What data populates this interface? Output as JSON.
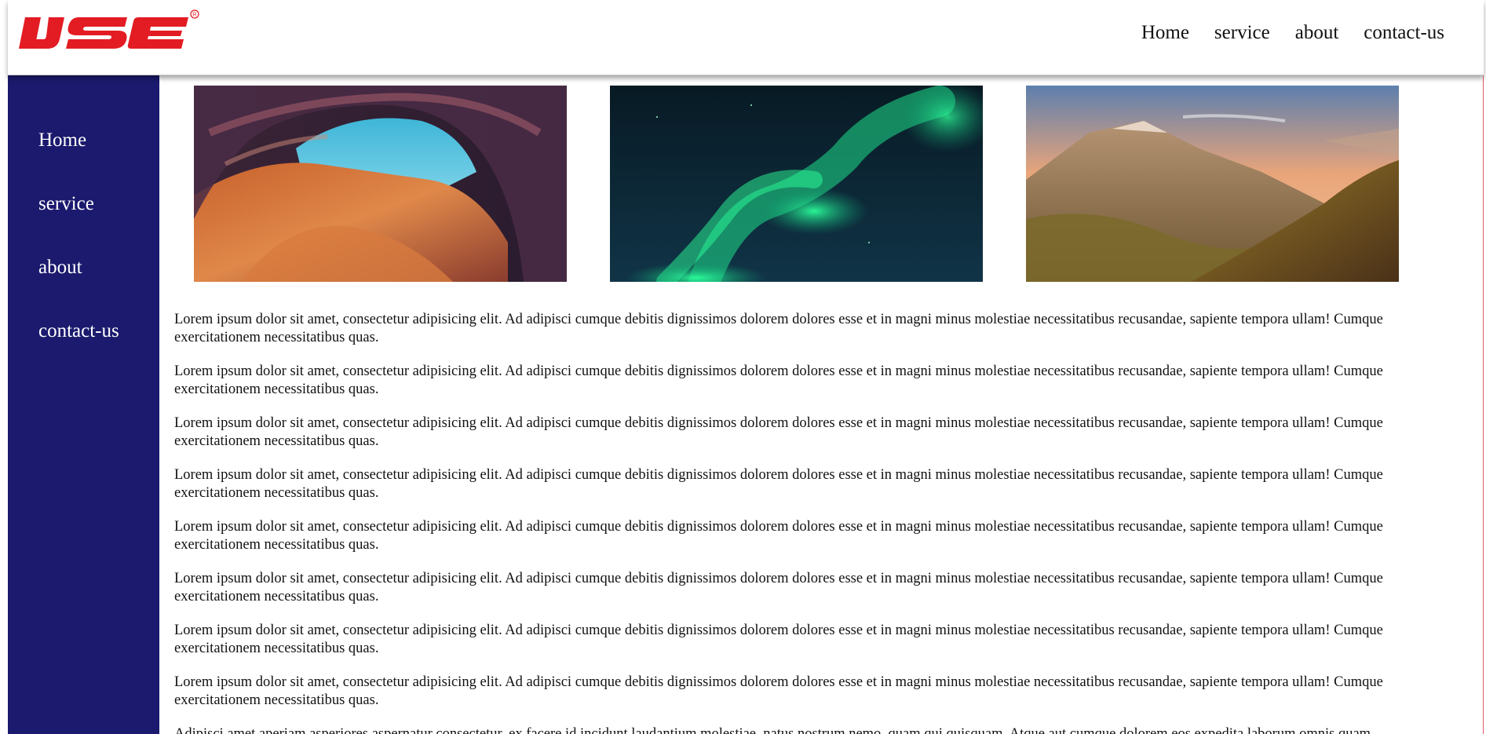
{
  "brand": {
    "logo_text": "IJSE",
    "logo_color": "#e31c23"
  },
  "header": {
    "nav": [
      "Home",
      "service",
      "about",
      "contact-us"
    ]
  },
  "sidebar": {
    "background": "#1b1a6e",
    "items": [
      "Home",
      "service",
      "about",
      "contact-us"
    ]
  },
  "gallery": {
    "images": [
      {
        "name": "canyon-image"
      },
      {
        "name": "aurora-image"
      },
      {
        "name": "mountain-image"
      }
    ]
  },
  "content": {
    "paragraphs": [
      "Lorem ipsum dolor sit amet, consectetur adipisicing elit. Ad adipisci cumque debitis dignissimos dolorem dolores esse et in magni minus molestiae necessitatibus recusandae, sapiente tempora ullam! Cumque exercitationem necessitatibus quas.",
      "Lorem ipsum dolor sit amet, consectetur adipisicing elit. Ad adipisci cumque debitis dignissimos dolorem dolores esse et in magni minus molestiae necessitatibus recusandae, sapiente tempora ullam! Cumque exercitationem necessitatibus quas.",
      "Lorem ipsum dolor sit amet, consectetur adipisicing elit. Ad adipisci cumque debitis dignissimos dolorem dolores esse et in magni minus molestiae necessitatibus recusandae, sapiente tempora ullam! Cumque exercitationem necessitatibus quas.",
      "Lorem ipsum dolor sit amet, consectetur adipisicing elit. Ad adipisci cumque debitis dignissimos dolorem dolores esse et in magni minus molestiae necessitatibus recusandae, sapiente tempora ullam! Cumque exercitationem necessitatibus quas.",
      "Lorem ipsum dolor sit amet, consectetur adipisicing elit. Ad adipisci cumque debitis dignissimos dolorem dolores esse et in magni minus molestiae necessitatibus recusandae, sapiente tempora ullam! Cumque exercitationem necessitatibus quas.",
      "Lorem ipsum dolor sit amet, consectetur adipisicing elit. Ad adipisci cumque debitis dignissimos dolorem dolores esse et in magni minus molestiae necessitatibus recusandae, sapiente tempora ullam! Cumque exercitationem necessitatibus quas.",
      "Lorem ipsum dolor sit amet, consectetur adipisicing elit. Ad adipisci cumque debitis dignissimos dolorem dolores esse et in magni minus molestiae necessitatibus recusandae, sapiente tempora ullam! Cumque exercitationem necessitatibus quas.",
      "Lorem ipsum dolor sit amet, consectetur adipisicing elit. Ad adipisci cumque debitis dignissimos dolorem dolores esse et in magni minus molestiae necessitatibus recusandae, sapiente tempora ullam! Cumque exercitationem necessitatibus quas.",
      "Adipisci amet aperiam asperiores aspernatur consectetur, ex facere id incidunt laudantium molestiae, natus nostrum nemo, quam qui quisquam. Atque aut cumque dolorem eos expedita laborum omnis quam"
    ]
  }
}
